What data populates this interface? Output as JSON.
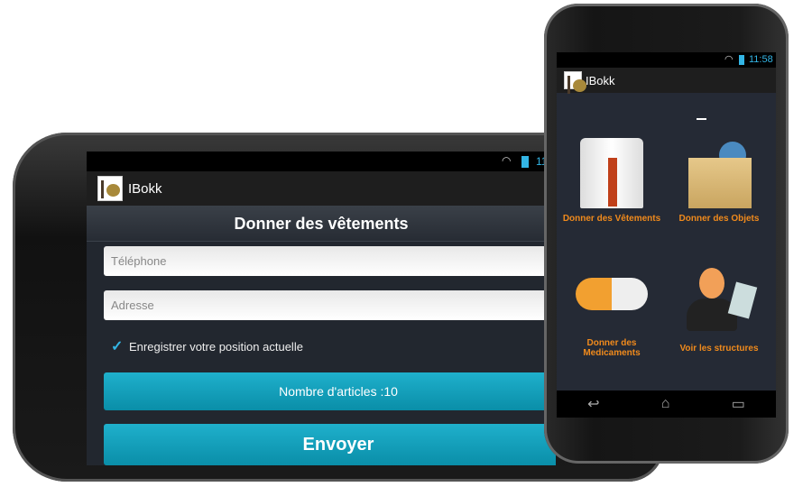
{
  "landscape": {
    "status": {
      "time": "11:58",
      "icons": [
        "wifi-icon",
        "battery-icon"
      ]
    },
    "app_title": "IBokk",
    "page_title": "Donner des vêtements",
    "phone_placeholder": "Téléphone",
    "address_placeholder": "Adresse",
    "checkbox": {
      "label": "Enregistrer votre position actuelle",
      "checked": true
    },
    "articles_button": "Nombre d'articles :10",
    "send_button": "Envoyer"
  },
  "portrait": {
    "status": {
      "time": "11:58",
      "icons": [
        "wifi-icon",
        "battery-icon"
      ]
    },
    "app_title": "IBokk",
    "tiles": [
      {
        "label": "Donner des Vêtements",
        "icon": "shirt-icon"
      },
      {
        "label": "Donner des Objets",
        "icon": "box-icon"
      },
      {
        "label": "Donner des Medicaments",
        "icon": "pill-icon"
      },
      {
        "label": "Voir les structures",
        "icon": "businessman-icon"
      }
    ],
    "nav": [
      "back-icon",
      "home-icon",
      "recent-apps-icon"
    ]
  },
  "colors": {
    "accent": "#33b5e5",
    "button": "#0a9cb8",
    "tile_label": "#f08a1c"
  }
}
